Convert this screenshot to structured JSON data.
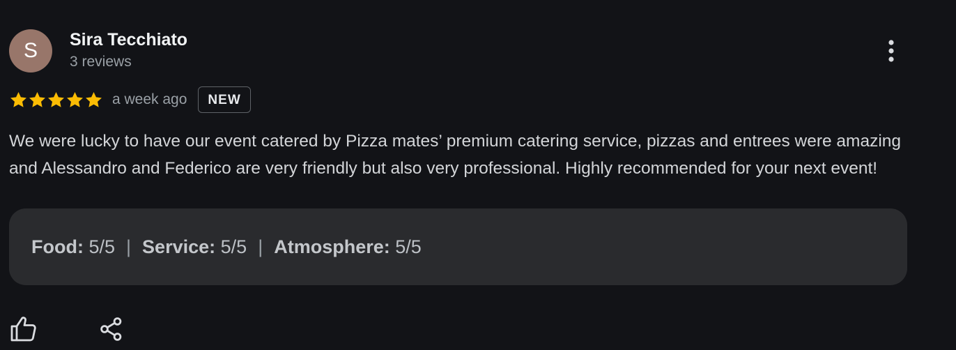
{
  "author": {
    "initial": "S",
    "name": "Sira Tecchiato",
    "meta": "3 reviews",
    "avatar_color": "#98766a"
  },
  "review": {
    "star_count": 5,
    "rating": 5,
    "time": "a week ago",
    "badge": "NEW",
    "text": "We were lucky to have our event catered by Pizza mates’ premium catering service, pizzas and entrees were amazing and Alessandro and Federico are very friendly but also very professional. Highly recommended for your next event!",
    "star_color": "#fbbc04"
  },
  "subratings": [
    {
      "label": "Food:",
      "value": "5/5"
    },
    {
      "label": "Service:",
      "value": "5/5"
    },
    {
      "label": "Atmosphere:",
      "value": "5/5"
    }
  ],
  "separator": "|",
  "icons": {
    "more": "more-vertical-icon",
    "like": "thumbs-up-icon",
    "share": "share-icon"
  }
}
